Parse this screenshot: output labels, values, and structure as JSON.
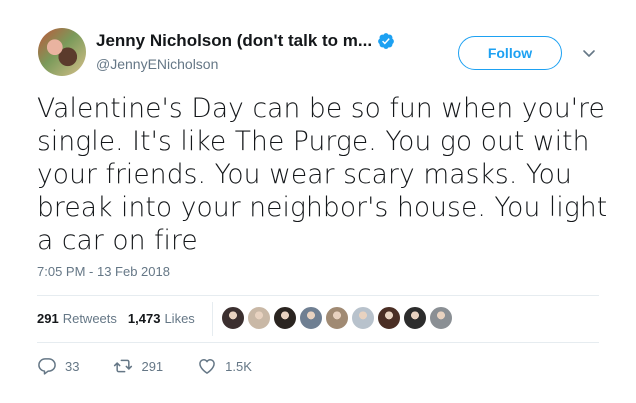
{
  "user": {
    "display_name": "Jenny Nicholson (don't talk to m...",
    "handle": "@JennyENicholson",
    "verified": true
  },
  "follow_button": {
    "label": "Follow"
  },
  "tweet": {
    "text": "Valentine's Day can be so fun when you're single. It's like The Purge. You go out with your friends. You wear scary masks. You break into your neighbor's house. You light a car on fire",
    "timestamp": "7:05 PM - 13 Feb 2018"
  },
  "stats": {
    "retweets_count": "291",
    "retweets_label": "Retweets",
    "likes_count": "1,473",
    "likes_label": "Likes"
  },
  "likers": [
    {
      "color": "#3b2f2f"
    },
    {
      "color": "#c9b8a6"
    },
    {
      "color": "#2a2420"
    },
    {
      "color": "#6f7f92"
    },
    {
      "color": "#a08a73"
    },
    {
      "color": "#b8c2cc"
    },
    {
      "color": "#4a2e24"
    },
    {
      "color": "#2c2c2c"
    },
    {
      "color": "#8a8f94"
    }
  ],
  "actions": {
    "replies": "33",
    "retweets": "291",
    "likes": "1.5K"
  },
  "colors": {
    "accent": "#1da1f2",
    "secondary_text": "#657786",
    "primary_text": "#14171a"
  }
}
